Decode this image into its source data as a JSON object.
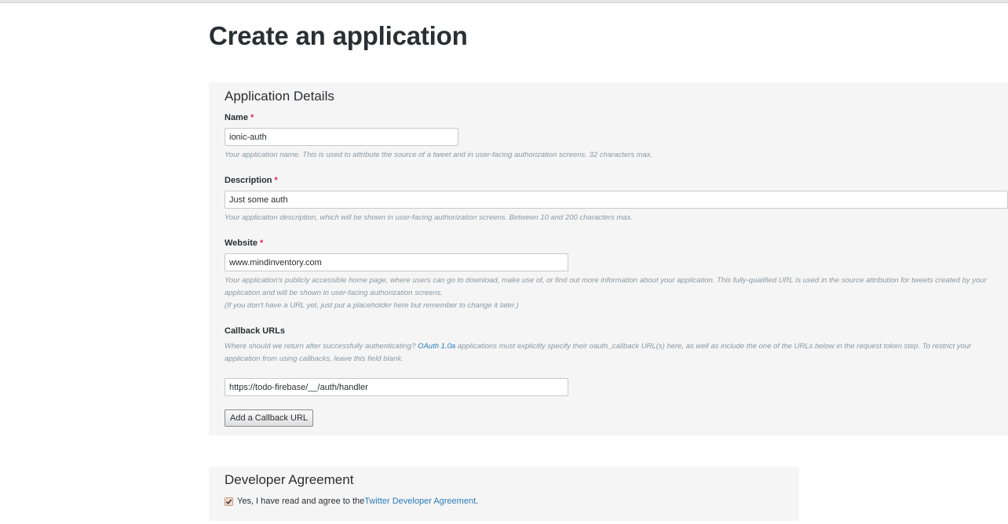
{
  "page": {
    "title": "Create an application"
  },
  "application_details": {
    "heading": "Application Details",
    "required_marker": "*",
    "name": {
      "label": "Name",
      "value": "ionic-auth",
      "help": "Your application name. This is used to attribute the source of a tweet and in user-facing authorization screens. 32 characters max."
    },
    "description": {
      "label": "Description",
      "value": "Just some auth",
      "help": "Your application description, which will be shown in user-facing authorization screens. Between 10 and 200 characters max."
    },
    "website": {
      "label": "Website",
      "value": "www.mindinventory.com",
      "help_line1": "Your application's publicly accessible home page, where users can go to download, make use of, or find out more information about your application. This fully-qualified URL is used in the source attribution for tweets created by your application and will be shown in user-facing authorization screens.",
      "help_line2": "(If you don't have a URL yet, just put a placeholder here but remember to change it later.)"
    },
    "callback": {
      "label": "Callback URLs",
      "help_before": "Where should we return after successfully authenticating? ",
      "help_link": "OAuth 1.0a",
      "help_after": " applications must explicitly specify their oauth_callback URL(s) here, as well as include the one of the URLs below in the request token step. To restrict your application from using callbacks, leave this field blank.",
      "value": "https://todo-firebase/__/auth/handler",
      "add_button": "Add a Callback URL"
    }
  },
  "developer_agreement": {
    "heading": "Developer Agreement",
    "checked": true,
    "text_before": "Yes, I have read and agree to the ",
    "link_text": "Twitter Developer Agreement",
    "text_after": "."
  },
  "colors": {
    "required": "#e0245e",
    "link": "#2b7bb9",
    "panel_bg": "#f5f5f5",
    "help_text": "#8899a6"
  }
}
